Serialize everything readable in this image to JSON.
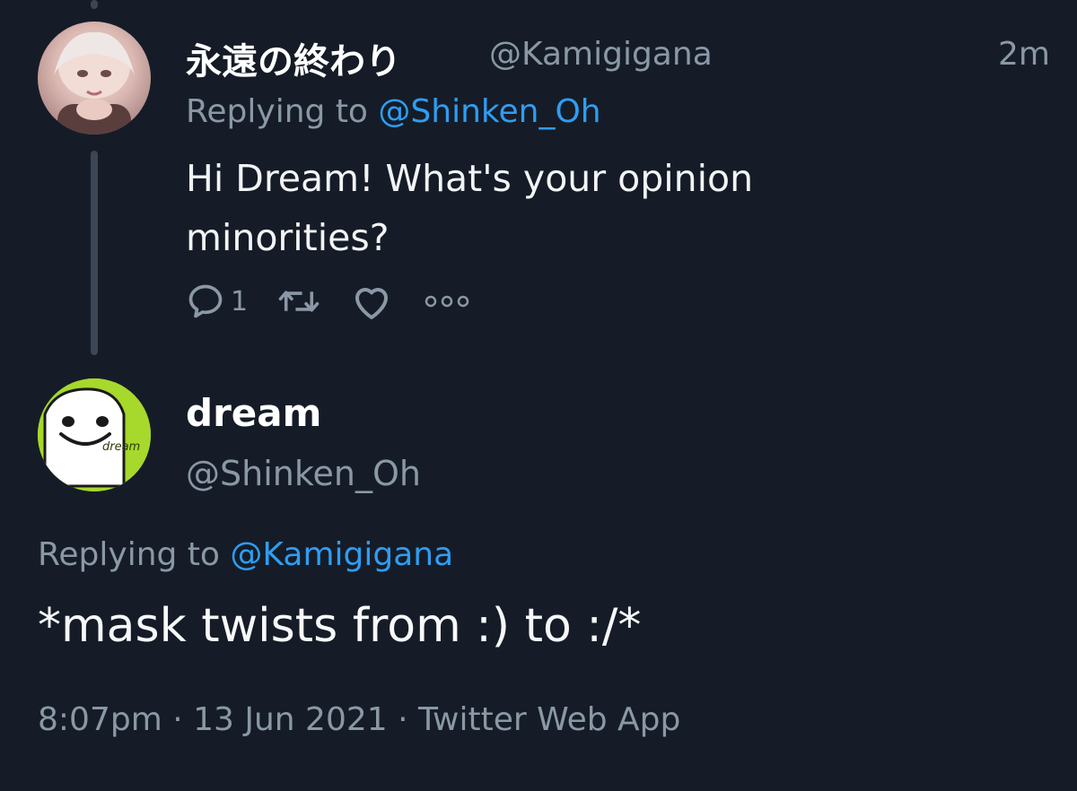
{
  "parent_tweet": {
    "display_name": "永遠の終わり",
    "handle": "@Kamigigana",
    "time_ago": "2m",
    "replying_to_label": "Replying to",
    "replying_to_handle": "@Shinken_Oh",
    "text": "Hi Dream! What's your opinion minorities?",
    "reply_count": "1",
    "avatar_icon": "anime-character-avatar"
  },
  "main_tweet": {
    "display_name": "dream",
    "handle": "@Shinken_Oh",
    "replying_to_label": "Replying to",
    "replying_to_handle": "@Kamigigana",
    "text": "*mask twists from :) to :/*",
    "timestamp": "8:07pm · 13 Jun 2021 · Twitter Web App",
    "avatar_icon": "dream-mask-logo",
    "avatar_logo_text": "dream"
  },
  "colors": {
    "background": "#151c27",
    "secondary_text": "#8a98a6",
    "link": "#2f9df2",
    "dream_green": "#a7d82c"
  }
}
